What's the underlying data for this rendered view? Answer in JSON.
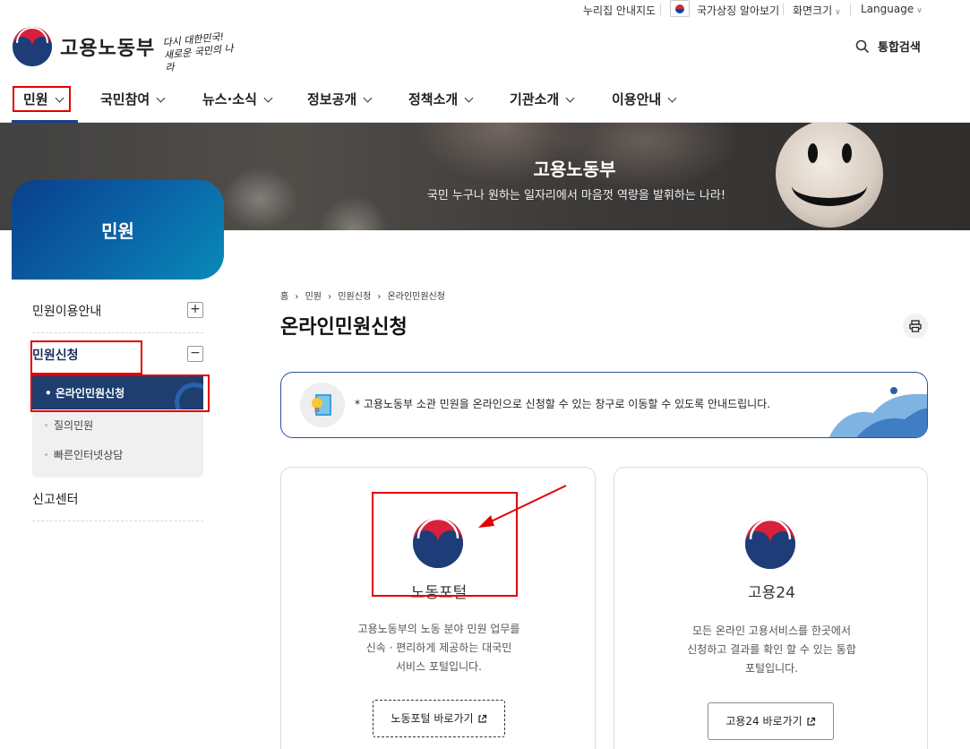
{
  "util": {
    "sitemap": "누리집 안내지도",
    "national_symbol": "국가상징 알아보기",
    "screen_size": "화면크기",
    "language": "Language"
  },
  "header": {
    "brand": "고용노동부",
    "slogan_line1": "다시 대한민국!",
    "slogan_line2": "새로운 국민의 나라",
    "search_label": "통합검색"
  },
  "gnb": {
    "items": [
      "민원",
      "국민참여",
      "뉴스·소식",
      "정보공개",
      "정책소개",
      "기관소개",
      "이용안내"
    ],
    "active_index": 0
  },
  "banner": {
    "title": "고용노동부",
    "subtitle": "국민 누구나 원하는 일자리에서 마음껏 역량을 발휘하는 나라!"
  },
  "lnb": {
    "title": "민원",
    "items": [
      {
        "label": "민원이용안내",
        "toggle": "+"
      },
      {
        "label": "민원신청",
        "toggle": "−"
      },
      {
        "label": "신고센터",
        "toggle": ""
      }
    ],
    "sub_items": [
      {
        "label": "• 온라인민원신청",
        "active": true
      },
      {
        "label": "질의민원",
        "active": false
      },
      {
        "label": "빠른인터넷상담",
        "active": false
      }
    ]
  },
  "content": {
    "breadcrumb": [
      "홈",
      "민원",
      "민원신청",
      "온라인민원신청"
    ],
    "breadcrumb_sep": "›",
    "page_title": "온라인민원신청",
    "notice": "* 고용노동부 소관 민원을 온라인으로 신청할 수 있는 창구로 이동할 수 있도록 안내드립니다.",
    "cards": [
      {
        "title": "노동포털",
        "desc_lines": [
          "고용노동부의 노동 분야 민원 업무를",
          "신속 · 편리하게 제공하는 대국민",
          "서비스 포털입니다."
        ],
        "button": "노동포털 바로가기"
      },
      {
        "title": "고용24",
        "desc_lines": [
          "모든 온라인 고용서비스를 한곳에서",
          "신청하고 결과를 확인 할 수 있는 통합",
          "포털입니다."
        ],
        "button": "고용24 바로가기"
      }
    ]
  },
  "colors": {
    "primary_navy": "#1a3f8f",
    "highlight_red": "#e00000",
    "taeguk_red": "#cd2e3a",
    "taeguk_blue": "#0047a0"
  }
}
